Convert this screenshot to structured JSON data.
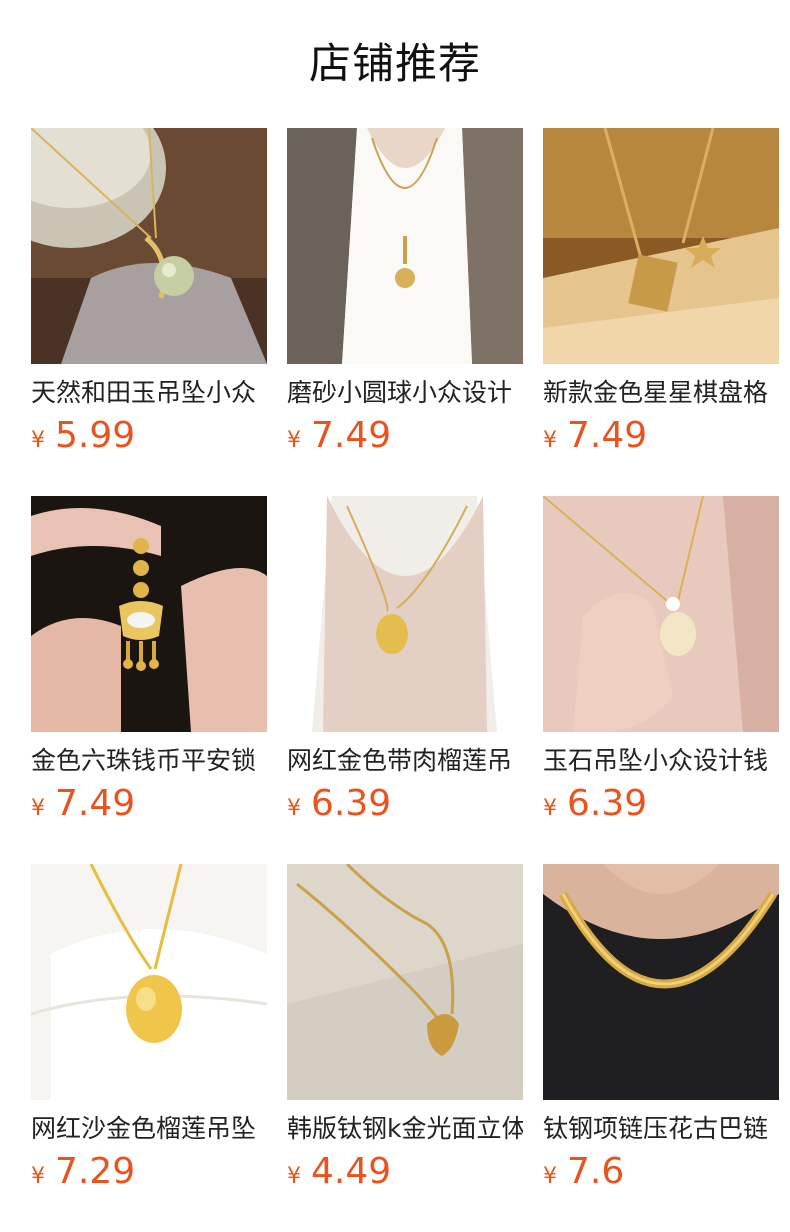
{
  "header": {
    "title": "店铺推荐"
  },
  "currency_symbol": "¥",
  "products": [
    {
      "name": "天然和田玉吊坠小众",
      "price": "5.99"
    },
    {
      "name": "磨砂小圆球小众设计",
      "price": "7.49"
    },
    {
      "name": "新款金色星星棋盘格",
      "price": "7.49"
    },
    {
      "name": "金色六珠钱币平安锁",
      "price": "7.49"
    },
    {
      "name": "网红金色带肉榴莲吊",
      "price": "6.39"
    },
    {
      "name": "玉石吊坠小众设计钱",
      "price": "6.39"
    },
    {
      "name": "网红沙金色榴莲吊坠",
      "price": "7.29"
    },
    {
      "name": "韩版钛钢k金光面立体",
      "price": "4.49"
    },
    {
      "name": "钛钢项链压花古巴链",
      "price": "7.6"
    }
  ],
  "colors": {
    "price": "#e8541e",
    "title": "#111111",
    "name": "#222222"
  }
}
